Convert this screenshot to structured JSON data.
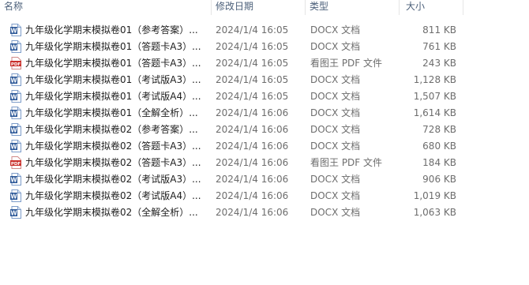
{
  "columns": {
    "name": "名称",
    "modified": "修改日期",
    "type": "类型",
    "size": "大小"
  },
  "files": [
    {
      "name": "九年级化学期末模拟卷01（参考答案）...",
      "modified": "2024/1/4 16:05",
      "type": "DOCX 文档",
      "size": "811 KB",
      "icon": "word-doc-icon"
    },
    {
      "name": "九年级化学期末模拟卷01（答题卡A3）...",
      "modified": "2024/1/4 16:05",
      "type": "DOCX 文档",
      "size": "761 KB",
      "icon": "word-doc-icon"
    },
    {
      "name": "九年级化学期末模拟卷01（答题卡A3）...",
      "modified": "2024/1/4 16:05",
      "type": "看图王 PDF 文件",
      "size": "243 KB",
      "icon": "pdf-icon"
    },
    {
      "name": "九年级化学期末模拟卷01（考试版A3）...",
      "modified": "2024/1/4 16:05",
      "type": "DOCX 文档",
      "size": "1,128 KB",
      "icon": "word-doc-icon"
    },
    {
      "name": "九年级化学期末模拟卷01（考试版A4）...",
      "modified": "2024/1/4 16:05",
      "type": "DOCX 文档",
      "size": "1,507 KB",
      "icon": "word-doc-icon"
    },
    {
      "name": "九年级化学期末模拟卷01（全解全析）...",
      "modified": "2024/1/4 16:06",
      "type": "DOCX 文档",
      "size": "1,614 KB",
      "icon": "word-doc-icon"
    },
    {
      "name": "九年级化学期末模拟卷02（参考答案）...",
      "modified": "2024/1/4 16:06",
      "type": "DOCX 文档",
      "size": "728 KB",
      "icon": "word-doc-icon"
    },
    {
      "name": "九年级化学期末模拟卷02（答题卡A3）...",
      "modified": "2024/1/4 16:06",
      "type": "DOCX 文档",
      "size": "680 KB",
      "icon": "word-doc-icon"
    },
    {
      "name": "九年级化学期末模拟卷02（答题卡A3）...",
      "modified": "2024/1/4 16:06",
      "type": "看图王 PDF 文件",
      "size": "184 KB",
      "icon": "pdf-icon"
    },
    {
      "name": "九年级化学期末模拟卷02（考试版A3）...",
      "modified": "2024/1/4 16:06",
      "type": "DOCX 文档",
      "size": "906 KB",
      "icon": "word-doc-icon"
    },
    {
      "name": "九年级化学期末模拟卷02（考试版A4）...",
      "modified": "2024/1/4 16:06",
      "type": "DOCX 文档",
      "size": "1,019 KB",
      "icon": "word-doc-icon"
    },
    {
      "name": "九年级化学期末模拟卷02（全解全析）...",
      "modified": "2024/1/4 16:06",
      "type": "DOCX 文档",
      "size": "1,063 KB",
      "icon": "word-doc-icon"
    }
  ],
  "colors": {
    "word_blue": "#2b5797",
    "pdf_red": "#c9302c",
    "header_text": "#4c607a"
  }
}
